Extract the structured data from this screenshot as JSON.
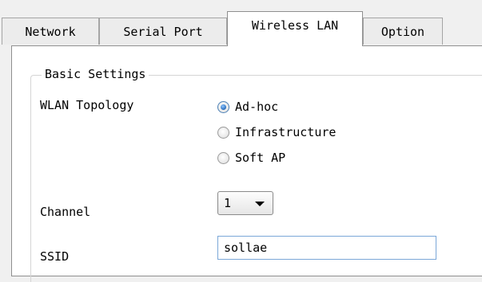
{
  "tabs": [
    {
      "label": "Network",
      "active": false
    },
    {
      "label": "Serial Port",
      "active": false
    },
    {
      "label": "Wireless LAN",
      "active": true
    },
    {
      "label": "Option",
      "active": false
    }
  ],
  "basic_settings": {
    "title": "Basic Settings",
    "wlan_topology": {
      "label": "WLAN Topology",
      "options": [
        {
          "label": "Ad-hoc",
          "selected": true
        },
        {
          "label": "Infrastructure",
          "selected": false
        },
        {
          "label": "Soft AP",
          "selected": false
        }
      ]
    },
    "channel": {
      "label": "Channel",
      "value": "1"
    },
    "ssid": {
      "label": "SSID",
      "value": "sollae"
    }
  },
  "colors": {
    "tab_bg": "#ececec",
    "panel_bg": "#ffffff",
    "radio_checked": "#1c5fb0",
    "input_border": "#7aa7d8"
  }
}
